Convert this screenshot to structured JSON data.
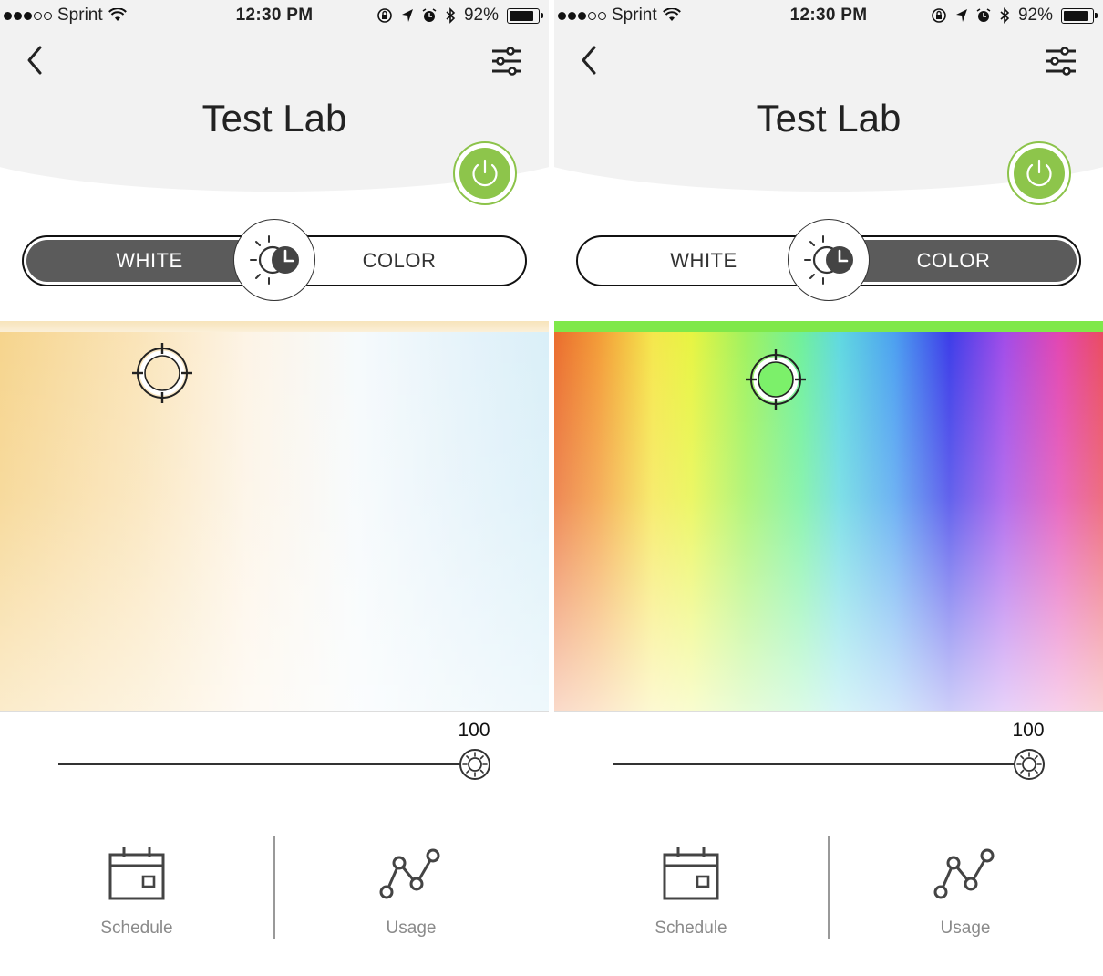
{
  "screens": [
    {
      "status": {
        "carrier": "Sprint",
        "time": "12:30 PM",
        "battery": "92%"
      },
      "header": {
        "title": "Test Lab"
      },
      "mode_toggle": {
        "white_label": "WHITE",
        "color_label": "COLOR",
        "active": "WHITE"
      },
      "brightness": {
        "value": "100",
        "level": 1.0
      },
      "nav": {
        "schedule_label": "Schedule",
        "usage_label": "Usage"
      }
    },
    {
      "status": {
        "carrier": "Sprint",
        "time": "12:30 PM",
        "battery": "92%"
      },
      "header": {
        "title": "Test Lab"
      },
      "mode_toggle": {
        "white_label": "WHITE",
        "color_label": "COLOR",
        "active": "COLOR"
      },
      "brightness": {
        "value": "100",
        "level": 1.0
      },
      "nav": {
        "schedule_label": "Schedule",
        "usage_label": "Usage"
      }
    }
  ],
  "colors": {
    "accent_power": "#8dc54b",
    "toggle_active": "#5b5b5b"
  },
  "icons": [
    "back-chevron-icon",
    "sliders-settings-icon",
    "power-icon",
    "sun-moon-clock-icon",
    "crosshair-icon",
    "brightness-sun-icon",
    "calendar-icon",
    "usage-graph-icon",
    "wifi-icon",
    "lock-rotation-icon",
    "location-arrow-icon",
    "alarm-clock-icon",
    "bluetooth-icon",
    "battery-icon"
  ]
}
